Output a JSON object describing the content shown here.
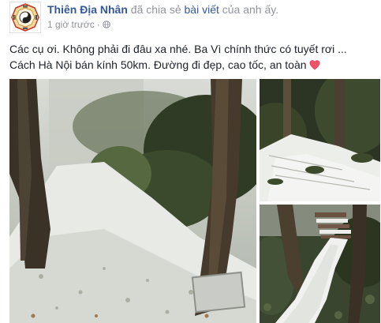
{
  "post": {
    "author": "Thiên Địa Nhân",
    "action_prefix": "đã chia sẻ",
    "action_link": "bài viết",
    "action_suffix": "của anh ấy.",
    "timestamp": "1 giờ trước",
    "text_line1": "Các cụ ơi. Không phải đi đâu xa nhé. Ba Vì chính thức có tuyết rơi ...",
    "text_line2": "Cách Hà Nội bán kính 50km. Đường đi đẹp, cao tốc, an toàn",
    "emoji": "heart-icon"
  },
  "photos": [
    {
      "name": "photo-main",
      "subject": "snow-covered forest path with trees"
    },
    {
      "name": "photo-top-right",
      "subject": "snow-covered stone steps"
    },
    {
      "name": "photo-bottom-right",
      "subject": "snowy path leading to stairs"
    }
  ],
  "colors": {
    "link": "#365899",
    "text": "#1d2129",
    "meta": "#90949c",
    "heart": "#f25268"
  }
}
